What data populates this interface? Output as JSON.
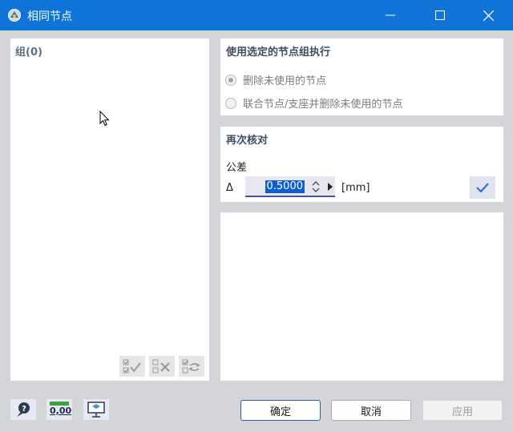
{
  "window": {
    "title": "相同节点"
  },
  "left_panel": {
    "group_label": "组(0)"
  },
  "execute_section": {
    "title": "使用选定的节点组执行",
    "options": [
      {
        "label": "删除未使用的节点",
        "checked": true
      },
      {
        "label": "联合节点/支座并删除未使用的节点",
        "checked": false
      }
    ]
  },
  "recheck_section": {
    "title": "再次核对",
    "tolerance_label": "公差",
    "delta_symbol": "Δ",
    "tolerance_value": "0.5000",
    "unit": "[mm]"
  },
  "footer": {
    "units_icon_text": "0,00",
    "ok_label": "确定",
    "cancel_label": "取消",
    "apply_label": "应用"
  },
  "colors": {
    "titlebar": "#0f74d8",
    "accent": "#0f5fd2"
  }
}
